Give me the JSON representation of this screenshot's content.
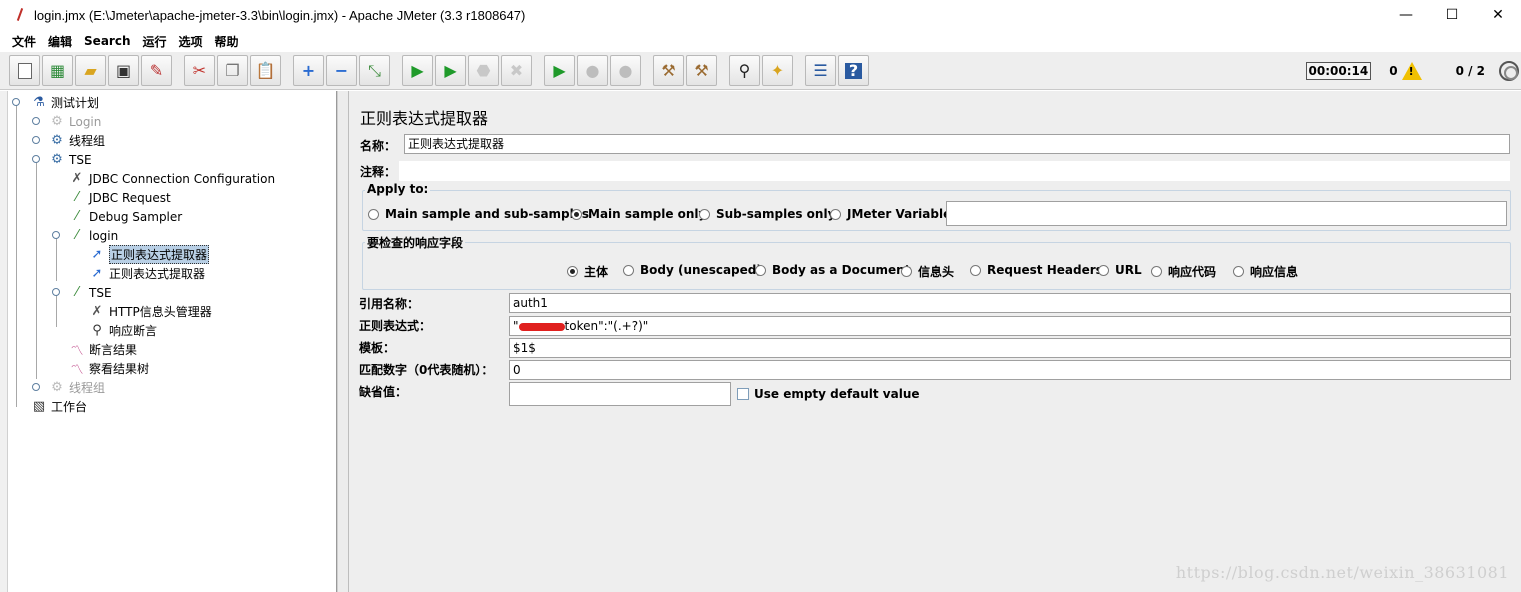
{
  "window": {
    "title": "login.jmx (E:\\Jmeter\\apache-jmeter-3.3\\bin\\login.jmx) - Apache JMeter (3.3 r1808647)",
    "minimize": "—",
    "maximize": "☐",
    "close": "✕"
  },
  "menu": [
    "文件",
    "编辑",
    "Search",
    "运行",
    "选项",
    "帮助"
  ],
  "toolbar": {
    "timer": "00:00:14",
    "error_count": "0",
    "threads": "0 / 2"
  },
  "tree": [
    {
      "label": "测试计划",
      "icon": "test-plan-icon"
    },
    {
      "label": "Login",
      "icon": "thread-group-icon",
      "disabled": true
    },
    {
      "label": "线程组",
      "icon": "thread-group-icon"
    },
    {
      "label": "TSE",
      "icon": "thread-group-icon"
    },
    {
      "label": "JDBC Connection Configuration",
      "icon": "config-wrench-icon"
    },
    {
      "label": "JDBC Request",
      "icon": "sampler-pipette-icon"
    },
    {
      "label": "Debug Sampler",
      "icon": "sampler-pipette-icon"
    },
    {
      "label": "login",
      "icon": "sampler-pipette-icon"
    },
    {
      "label": "正则表达式提取器",
      "icon": "post-processor-icon",
      "selected": true
    },
    {
      "label": "正则表达式提取器",
      "icon": "post-processor-icon"
    },
    {
      "label": "TSE",
      "icon": "sampler-pipette-icon"
    },
    {
      "label": "HTTP信息头管理器",
      "icon": "config-wrench-icon"
    },
    {
      "label": "响应断言",
      "icon": "assertion-magnifier-icon"
    },
    {
      "label": "断言结果",
      "icon": "listener-graph-icon"
    },
    {
      "label": "察看结果树",
      "icon": "listener-graph-icon"
    },
    {
      "label": "线程组",
      "icon": "thread-group-icon",
      "disabled": true
    },
    {
      "label": "工作台",
      "icon": "workbench-icon"
    }
  ],
  "form": {
    "title": "正则表达式提取器",
    "name_label": "名称：",
    "name_value": "正则表达式提取器",
    "comment_label": "注释：",
    "comment_value": "",
    "apply_to": {
      "title": "Apply to:",
      "options": [
        "Main sample and sub-samples",
        "Main sample only",
        "Sub-samples only",
        "JMeter Variable"
      ],
      "selected": "Main sample only",
      "variable_value": ""
    },
    "field_to_check": {
      "title": "要检查的响应字段",
      "options": [
        "主体",
        "Body (unescaped)",
        "Body as a Document",
        "信息头",
        "Request Headers",
        "URL",
        "响应代码",
        "响应信息"
      ],
      "selected": "主体"
    },
    "ref_name_label": "引用名称：",
    "ref_name_value": "auth1",
    "regex_label": "正则表达式：",
    "regex_prefix": "\"",
    "regex_suffix": "token\":\"(.+?)\"",
    "template_label": "模板：",
    "template_value": "$1$",
    "match_no_label": "匹配数字（0代表随机）：",
    "match_no_value": "0",
    "default_label": "缺省值：",
    "default_value": "",
    "use_empty_label": "Use empty default value"
  },
  "watermark": "https://blog.csdn.net/weixin_38631081"
}
